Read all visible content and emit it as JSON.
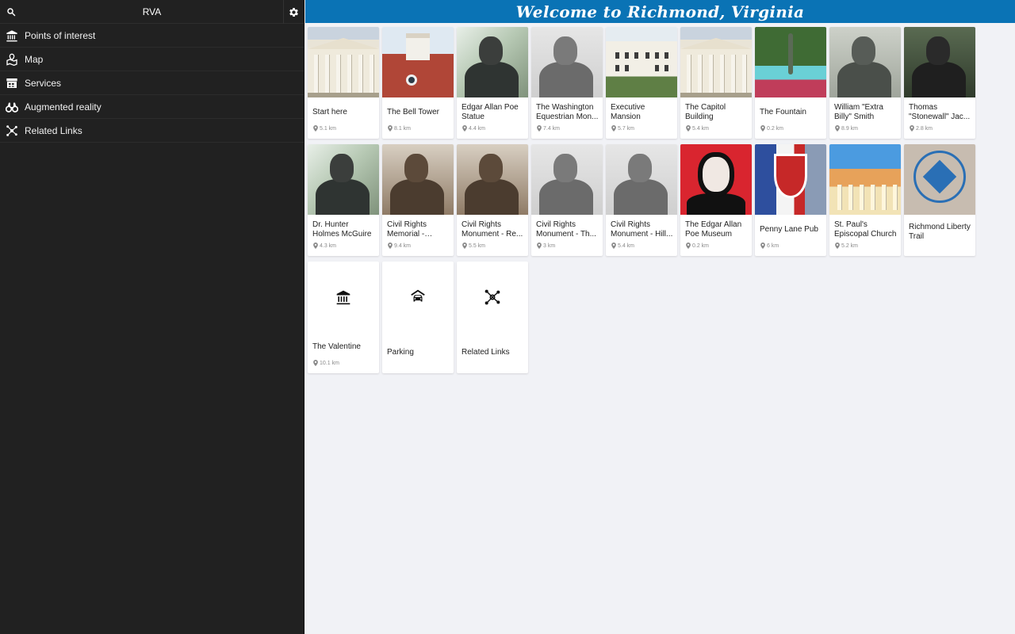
{
  "sidebar": {
    "search_icon": "search-icon",
    "title": "RVA",
    "settings_icon": "gear-icon",
    "items": [
      {
        "label": "Points of interest",
        "icon": "museum-icon"
      },
      {
        "label": "Map",
        "icon": "map-icon"
      },
      {
        "label": "Services",
        "icon": "storefront-icon"
      },
      {
        "label": "Augmented reality",
        "icon": "binoculars-icon"
      },
      {
        "label": "Related Links",
        "icon": "network-icon"
      }
    ]
  },
  "header": {
    "title": "Welcome to Richmond, Virginia",
    "bg_color": "#0a73b5"
  },
  "cards": [
    {
      "title": "Start here",
      "distance": "5.1 km"
    },
    {
      "title": "The Bell Tower",
      "distance": "8.1 km"
    },
    {
      "title": "Edgar Allan Poe Statue",
      "distance": "4.4 km"
    },
    {
      "title": "The Washington Equestrian Mon...",
      "distance": "7.4 km"
    },
    {
      "title": "Executive Mansion",
      "distance": "5.7 km"
    },
    {
      "title": "The Capitol Building",
      "distance": "5.4 km"
    },
    {
      "title": "The Fountain",
      "distance": "0.2 km"
    },
    {
      "title": "William \"Extra Billy\" Smith",
      "distance": "8.9 km"
    },
    {
      "title": "Thomas \"Stonewall\" Jac...",
      "distance": "2.8 km"
    },
    {
      "title": "Dr. Hunter Holmes McGuire",
      "distance": "4.3 km"
    },
    {
      "title": "Civil Rights Memorial - Barb...",
      "distance": "9.4 km"
    },
    {
      "title": "Civil Rights Monument - Re...",
      "distance": "5.5 km"
    },
    {
      "title": "Civil Rights Monument - Th...",
      "distance": "3 km"
    },
    {
      "title": "Civil Rights Monument - Hill...",
      "distance": "5.4 km"
    },
    {
      "title": "The Edgar Allan Poe Museum",
      "distance": "0.2 km"
    },
    {
      "title": "Penny Lane Pub",
      "distance": "6 km"
    },
    {
      "title": "St. Paul's Episcopal Church",
      "distance": "5.2 km"
    },
    {
      "title": "Richmond Liberty Trail",
      "distance": ""
    },
    {
      "title": "The Valentine",
      "distance": "10.1 km"
    },
    {
      "title": "Parking",
      "distance": ""
    },
    {
      "title": "Related Links",
      "distance": ""
    }
  ]
}
